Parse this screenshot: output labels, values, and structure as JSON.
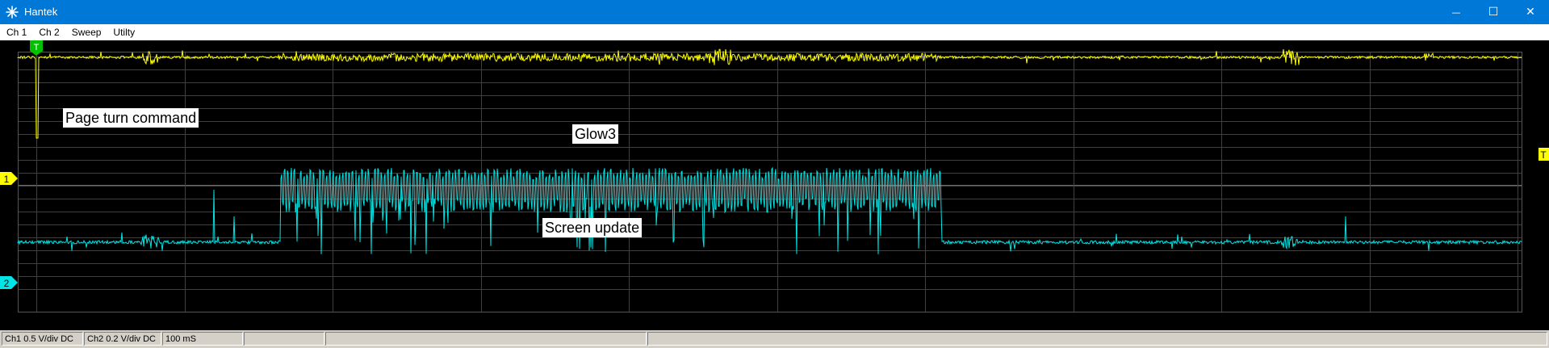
{
  "window": {
    "title": "Hantek",
    "minimize_glyph": "—",
    "maximize_glyph": "☐",
    "close_glyph": "✕"
  },
  "menu": {
    "items": [
      "Ch 1",
      "Ch 2",
      "Sweep",
      "Utilty"
    ]
  },
  "scope": {
    "trigger_marker": "T",
    "trigger_level_marker": "T",
    "ch1_marker": "1",
    "ch2_marker": "2",
    "ch1_color": "#ffff00",
    "ch2_color": "#00e5e5",
    "trigger_color": "#00c000",
    "grid_color": "#404040",
    "annotations": {
      "page_turn": "Page turn command",
      "glow": "Glow3",
      "screen_update": "Screen update"
    }
  },
  "status": {
    "ch1": "Ch1 0.5 V/div DC",
    "ch2": "Ch2 0.2 V/div DC",
    "timebase": "100 mS",
    "extra1": "",
    "extra2": "",
    "extra3": ""
  }
}
